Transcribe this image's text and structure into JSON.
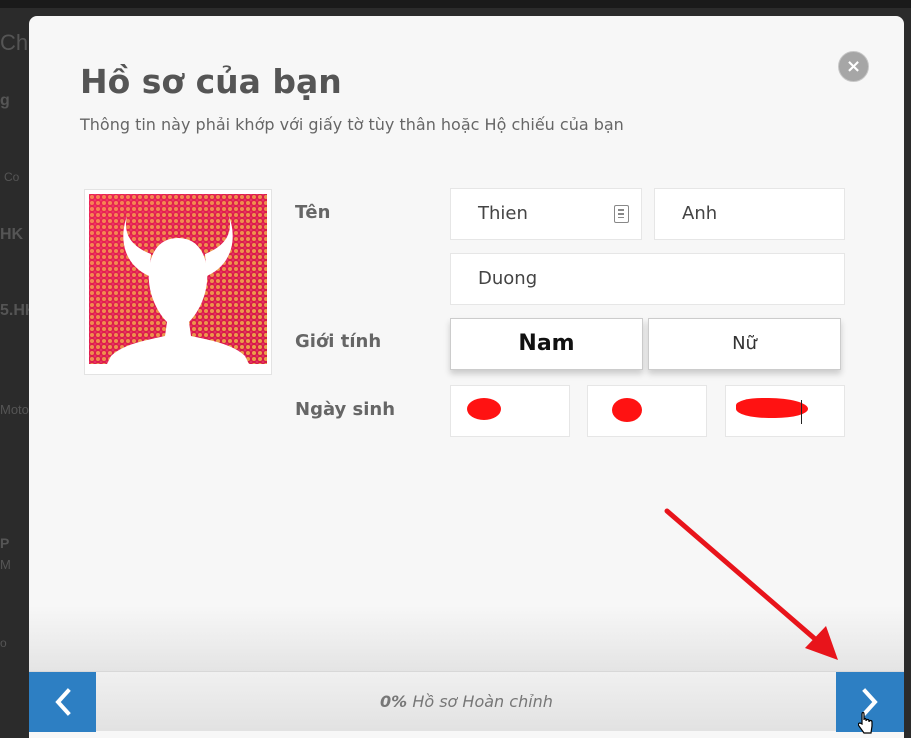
{
  "background": {
    "fragments": [
      "Ch",
      "g",
      "Co",
      "HK",
      "5.HK",
      "Moto",
      "P",
      "M",
      "o"
    ]
  },
  "modal": {
    "title": "Hồ sơ của bạn",
    "subtitle": "Thông tin này phải khớp với giấy tờ tùy thân hoặc Hộ chiếu của bạn",
    "close_icon": "×"
  },
  "form": {
    "name_label": "Tên",
    "first_name": "Thien",
    "middle_name": "Anh",
    "last_name": "Duong",
    "gender_label": "Giới tính",
    "gender_options": [
      "Nam",
      "Nữ"
    ],
    "gender_selected": "Nam",
    "dob_label": "Ngày sinh"
  },
  "footer": {
    "progress_percent": "0%",
    "progress_label": "Hồ sơ Hoàn chỉnh"
  },
  "colors": {
    "accent": "#2d7fc3",
    "annotation": "#e8141b",
    "redaction": "#ff1212"
  }
}
